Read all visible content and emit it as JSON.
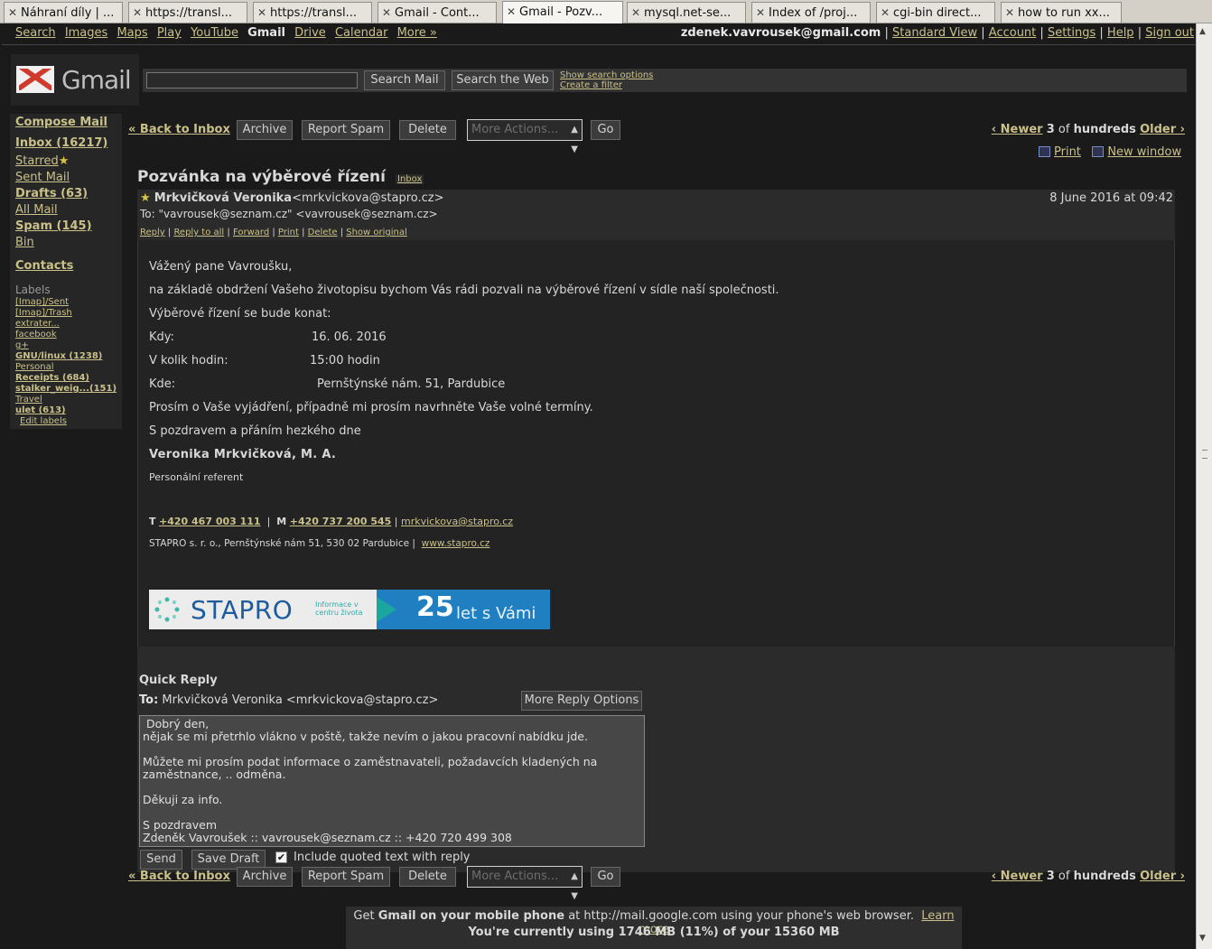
{
  "browser_tabs": [
    {
      "label": "Náhraní díly | ...",
      "active": false
    },
    {
      "label": "https://transl...",
      "active": false
    },
    {
      "label": "https://transl...",
      "active": false
    },
    {
      "label": "Gmail - Cont...",
      "active": false
    },
    {
      "label": "Gmail - Pozv...",
      "active": true
    },
    {
      "label": "mysql.net-se...",
      "active": false
    },
    {
      "label": "Index of /proj...",
      "active": false
    },
    {
      "label": "cgi-bin direct...",
      "active": false
    },
    {
      "label": "how to run xx...",
      "active": false
    }
  ],
  "gbar": {
    "links": [
      "Search",
      "Images",
      "Maps",
      "Play",
      "YouTube"
    ],
    "current": "Gmail",
    "links2": [
      "Drive",
      "Calendar",
      "More »"
    ],
    "account_email": "zdenek.vavrousek@gmail.com",
    "right_links": [
      "Standard View",
      "Account",
      "Settings",
      "Help",
      "Sign out"
    ]
  },
  "header": {
    "logo_text": "Gmail",
    "search_mail_button": "Search Mail",
    "search_web_button": "Search the Web",
    "show_search_options": "Show search options",
    "create_filter": "Create a filter"
  },
  "sidebar": {
    "compose": "Compose Mail",
    "inbox": "Inbox (16217)",
    "starred": "Starred",
    "sent": "Sent Mail",
    "drafts": "Drafts (63)",
    "all_mail": "All Mail",
    "spam": "Spam (145)",
    "bin": "Bin",
    "contacts": "Contacts",
    "labels_heading": "Labels",
    "labels": [
      {
        "text": "[Imap]/Sent",
        "bold": false
      },
      {
        "text": "[Imap]/Trash",
        "bold": false
      },
      {
        "text": "extrater...",
        "bold": false
      },
      {
        "text": "facebook",
        "bold": false
      },
      {
        "text": "g+",
        "bold": false
      },
      {
        "text": "GNU/linux (1238)",
        "bold": true
      },
      {
        "text": "Personal",
        "bold": false
      },
      {
        "text": "Receipts (684)",
        "bold": true
      },
      {
        "text": "stalker_weig...(151)",
        "bold": true
      },
      {
        "text": "Travel",
        "bold": false
      },
      {
        "text": "ulet (613)",
        "bold": true
      }
    ],
    "edit_labels": "Edit labels"
  },
  "toolbar": {
    "back": "« Back to Inbox",
    "archive": "Archive",
    "report_spam": "Report Spam",
    "delete": "Delete",
    "more_actions": "More Actions...",
    "go": "Go",
    "newer": "‹ Newer",
    "position": "3",
    "of": "of",
    "total": "hundreds",
    "older": "Older ›"
  },
  "print_row": {
    "print": "Print",
    "new_window": "New window"
  },
  "message": {
    "subject": "Pozvánka na výběrové řízení",
    "label_tag": "Inbox",
    "from_name": "Mrkvičková Veronika",
    "from_email": "<mrkvickova@stapro.cz>",
    "date": "8 June 2016 at 09:42",
    "to": "To: \"vavrousek@seznam.cz\" <vavrousek@seznam.cz>",
    "actions": [
      "Reply",
      "Reply to all",
      "Forward",
      "Print",
      "Delete",
      "Show original"
    ],
    "body": {
      "greeting": "Vážený pane Vavroušku,",
      "p1": "na základě obdržení Vašeho životopisu bychom Vás rádi pozvali na výběrové řízení v sídle naší společnosti.",
      "p2": "Výběrové řízení se bude konat:",
      "when_label": "Kdy:",
      "when_value": "16. 06. 2016",
      "time_label": "V kolik hodin:",
      "time_value": "15:00 hodin",
      "where_label": "Kde:",
      "where_value": "Pernštýnské nám. 51, Pardubice",
      "p3": "Prosím o Vaše vyjádření, případně mi prosím navrhněte Vaše volné termíny.",
      "p4": "S pozdravem a přáním hezkého dne",
      "sig_name": "Veronika Mrkvičková, M. A.",
      "sig_role": "Personální referent",
      "sig_t_label": "T",
      "sig_phone": "+420 467 003 111",
      "sig_m_label": "M",
      "sig_mobile": "+420 737 200 545",
      "sig_email": "mrkvickova@stapro.cz",
      "sig_company": "STAPRO s. r. o., Pernštýnské nám 51, 530 02 Pardubice  |",
      "sig_web": "www.stapro.cz",
      "banner_brand": "STAPRO",
      "banner_tag": "Informace v centru života",
      "banner_number": "25",
      "banner_text": "let s Vámi"
    }
  },
  "quick_reply": {
    "title": "Quick Reply",
    "to_label": "To:",
    "to_value": "Mrkvičková Veronika <mrkvickova@stapro.cz>",
    "more_options": "More Reply Options",
    "text": " Dobrý den,\nnějak se mi přetrhlo vlákno v poště, takže nevím o jakou pracovní nabídku jde.\n\nMůžete mi prosím podat informace o zaměstnavateli, požadavcích kladených na\nzaměstnance, .. odměna.\n\nDěkuji za info.\n\nS pozdravem\nZdeněk Vavroušek :: vavrousek@seznam.cz :: +420 720 499 308",
    "send": "Send",
    "save_draft": "Save Draft",
    "include_quoted": "Include quoted text with reply",
    "include_checked": true
  },
  "footer": {
    "get": "Get",
    "mobile_bold": "Gmail on your mobile phone",
    "mobile_rest": "at http://mail.google.com using your phone's web browser.",
    "learn_more": "Learn more",
    "usage": "You're currently using 1746 MB (11%) of your 15360 MB"
  },
  "colors": {
    "link": "#c9c08a",
    "background": "#1a1a1a",
    "banner_blue": "#1f7fc0"
  }
}
